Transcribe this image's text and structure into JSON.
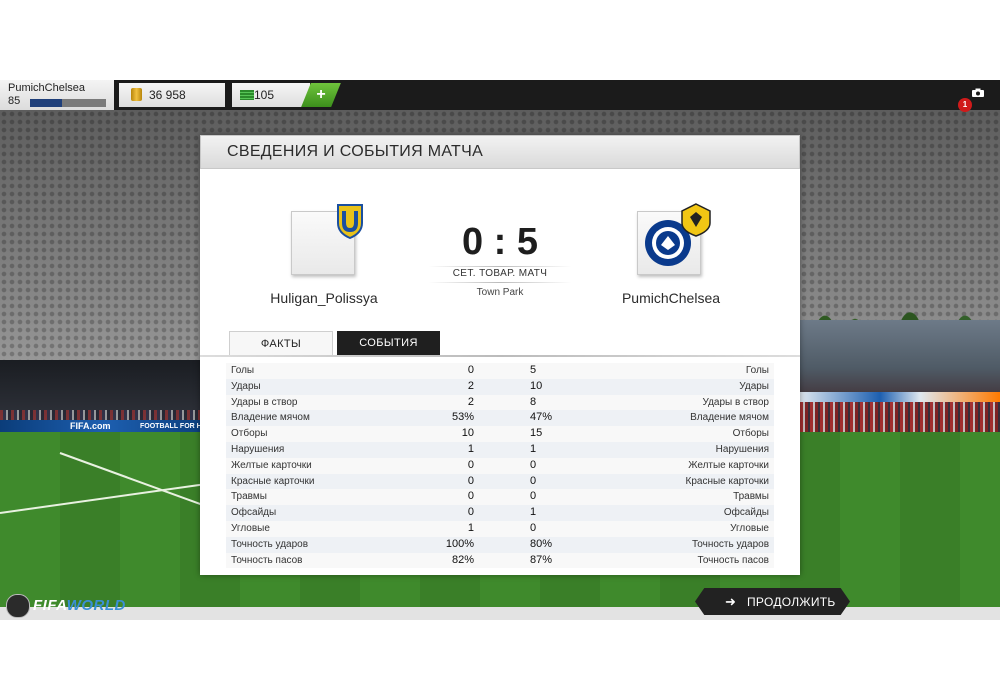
{
  "topbar": {
    "player_name": "PumichChelsea",
    "player_level": "85",
    "level_progress": 0.42,
    "coins": "36 958",
    "points": "105",
    "add_label": "+",
    "notification_count": "1"
  },
  "panel": {
    "title": "СВЕДЕНИЯ И СОБЫТИЯ МАТЧА",
    "home_team": "Huligan_Polissya",
    "away_team": "PumichChelsea",
    "score": "0 : 5",
    "match_type": "СЕТ. ТОВАР. МАТЧ",
    "stadium": "Town Park",
    "tabs": {
      "facts": "ФАКТЫ",
      "events": "СОБЫТИЯ"
    },
    "stats": [
      {
        "label": "Голы",
        "home": "0",
        "away": "5"
      },
      {
        "label": "Удары",
        "home": "2",
        "away": "10"
      },
      {
        "label": "Удары в створ",
        "home": "2",
        "away": "8"
      },
      {
        "label": "Владение мячом",
        "home": "53%",
        "away": "47%"
      },
      {
        "label": "Отборы",
        "home": "10",
        "away": "15"
      },
      {
        "label": "Нарушения",
        "home": "1",
        "away": "1"
      },
      {
        "label": "Желтые карточки",
        "home": "0",
        "away": "0"
      },
      {
        "label": "Красные карточки",
        "home": "0",
        "away": "0"
      },
      {
        "label": "Травмы",
        "home": "0",
        "away": "0"
      },
      {
        "label": "Офсайды",
        "home": "0",
        "away": "1"
      },
      {
        "label": "Угловые",
        "home": "1",
        "away": "0"
      },
      {
        "label": "Точность ударов",
        "home": "100%",
        "away": "80%"
      },
      {
        "label": "Точность пасов",
        "home": "82%",
        "away": "87%"
      }
    ]
  },
  "footer": {
    "logo_ea": "EA",
    "logo_fifa": "FIFA",
    "logo_world": "WORLD",
    "continue_label": "ПРОДОЛЖИТЬ"
  },
  "background": {
    "ad_left_1": "FIFA.com",
    "ad_left_2": "FOOTBALL FOR H"
  },
  "colors": {
    "accent_green": "#3c8f1c",
    "dark": "#1f1f1f",
    "notification": "#d01a1a"
  },
  "icons": {
    "coins": "coins-icon",
    "points": "points-icon",
    "camera": "camera-icon",
    "continue": "arrow-right-icon"
  }
}
